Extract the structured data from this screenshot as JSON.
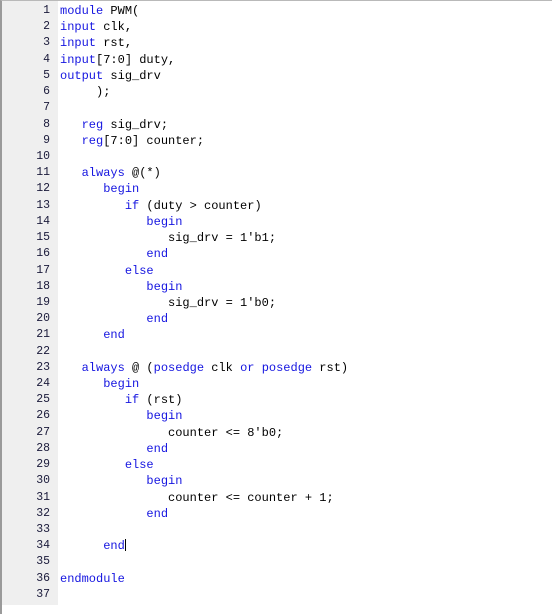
{
  "editor": {
    "name": "verilog-code-editor",
    "language": "Verilog",
    "total_lines": 37,
    "cursor": {
      "line": 34,
      "column": 12
    },
    "colors": {
      "background": "#ffffff",
      "gutter_background": "#efefef",
      "keyword": "#1515e0",
      "plain_text": "#000000",
      "line_number": "#1a1a3a",
      "left_border": "#9a9a9a"
    },
    "line_numbers": [
      "1",
      "2",
      "3",
      "4",
      "5",
      "6",
      "7",
      "8",
      "9",
      "10",
      "11",
      "12",
      "13",
      "14",
      "15",
      "16",
      "17",
      "18",
      "19",
      "20",
      "21",
      "22",
      "23",
      "24",
      "25",
      "26",
      "27",
      "28",
      "29",
      "30",
      "31",
      "32",
      "33",
      "34",
      "35",
      "36",
      "37"
    ],
    "lines": [
      {
        "n": 1,
        "tokens": [
          {
            "t": "module",
            "k": true
          },
          {
            "t": " PWM(",
            "k": false
          }
        ]
      },
      {
        "n": 2,
        "tokens": [
          {
            "t": "input",
            "k": true
          },
          {
            "t": " clk,",
            "k": false
          }
        ]
      },
      {
        "n": 3,
        "tokens": [
          {
            "t": "input",
            "k": true
          },
          {
            "t": " rst,",
            "k": false
          }
        ]
      },
      {
        "n": 4,
        "tokens": [
          {
            "t": "input",
            "k": true
          },
          {
            "t": "[7:0] duty,",
            "k": false
          }
        ]
      },
      {
        "n": 5,
        "tokens": [
          {
            "t": "output",
            "k": true
          },
          {
            "t": " sig_drv",
            "k": false
          }
        ]
      },
      {
        "n": 6,
        "tokens": [
          {
            "t": "     );",
            "k": false
          }
        ]
      },
      {
        "n": 7,
        "tokens": [
          {
            "t": "",
            "k": false
          }
        ]
      },
      {
        "n": 8,
        "tokens": [
          {
            "t": "   ",
            "k": false
          },
          {
            "t": "reg",
            "k": true
          },
          {
            "t": " sig_drv;",
            "k": false
          }
        ]
      },
      {
        "n": 9,
        "tokens": [
          {
            "t": "   ",
            "k": false
          },
          {
            "t": "reg",
            "k": true
          },
          {
            "t": "[7:0] counter;",
            "k": false
          }
        ]
      },
      {
        "n": 10,
        "tokens": [
          {
            "t": "",
            "k": false
          }
        ]
      },
      {
        "n": 11,
        "tokens": [
          {
            "t": "   ",
            "k": false
          },
          {
            "t": "always",
            "k": true
          },
          {
            "t": " @(*)",
            "k": false
          }
        ]
      },
      {
        "n": 12,
        "tokens": [
          {
            "t": "      ",
            "k": false
          },
          {
            "t": "begin",
            "k": true
          }
        ]
      },
      {
        "n": 13,
        "tokens": [
          {
            "t": "         ",
            "k": false
          },
          {
            "t": "if",
            "k": true
          },
          {
            "t": " (duty > counter)",
            "k": false
          }
        ]
      },
      {
        "n": 14,
        "tokens": [
          {
            "t": "            ",
            "k": false
          },
          {
            "t": "begin",
            "k": true
          }
        ]
      },
      {
        "n": 15,
        "tokens": [
          {
            "t": "               sig_drv = 1'b1;",
            "k": false
          }
        ]
      },
      {
        "n": 16,
        "tokens": [
          {
            "t": "            ",
            "k": false
          },
          {
            "t": "end",
            "k": true
          }
        ]
      },
      {
        "n": 17,
        "tokens": [
          {
            "t": "         ",
            "k": false
          },
          {
            "t": "else",
            "k": true
          }
        ]
      },
      {
        "n": 18,
        "tokens": [
          {
            "t": "            ",
            "k": false
          },
          {
            "t": "begin",
            "k": true
          }
        ]
      },
      {
        "n": 19,
        "tokens": [
          {
            "t": "               sig_drv = 1'b0;",
            "k": false
          }
        ]
      },
      {
        "n": 20,
        "tokens": [
          {
            "t": "            ",
            "k": false
          },
          {
            "t": "end",
            "k": true
          }
        ]
      },
      {
        "n": 21,
        "tokens": [
          {
            "t": "      ",
            "k": false
          },
          {
            "t": "end",
            "k": true
          }
        ]
      },
      {
        "n": 22,
        "tokens": [
          {
            "t": "",
            "k": false
          }
        ]
      },
      {
        "n": 23,
        "tokens": [
          {
            "t": "   ",
            "k": false
          },
          {
            "t": "always",
            "k": true
          },
          {
            "t": " @ (",
            "k": false
          },
          {
            "t": "posedge",
            "k": true
          },
          {
            "t": " clk ",
            "k": false
          },
          {
            "t": "or",
            "k": true
          },
          {
            "t": " ",
            "k": false
          },
          {
            "t": "posedge",
            "k": true
          },
          {
            "t": " rst)",
            "k": false
          }
        ]
      },
      {
        "n": 24,
        "tokens": [
          {
            "t": "      ",
            "k": false
          },
          {
            "t": "begin",
            "k": true
          }
        ]
      },
      {
        "n": 25,
        "tokens": [
          {
            "t": "         ",
            "k": false
          },
          {
            "t": "if",
            "k": true
          },
          {
            "t": " (rst)",
            "k": false
          }
        ]
      },
      {
        "n": 26,
        "tokens": [
          {
            "t": "            ",
            "k": false
          },
          {
            "t": "begin",
            "k": true
          }
        ]
      },
      {
        "n": 27,
        "tokens": [
          {
            "t": "               counter <= 8'b0;",
            "k": false
          }
        ]
      },
      {
        "n": 28,
        "tokens": [
          {
            "t": "            ",
            "k": false
          },
          {
            "t": "end",
            "k": true
          }
        ]
      },
      {
        "n": 29,
        "tokens": [
          {
            "t": "         ",
            "k": false
          },
          {
            "t": "else",
            "k": true
          }
        ]
      },
      {
        "n": 30,
        "tokens": [
          {
            "t": "            ",
            "k": false
          },
          {
            "t": "begin",
            "k": true
          }
        ]
      },
      {
        "n": 31,
        "tokens": [
          {
            "t": "               counter <= counter + 1;",
            "k": false
          }
        ]
      },
      {
        "n": 32,
        "tokens": [
          {
            "t": "            ",
            "k": false
          },
          {
            "t": "end",
            "k": true
          }
        ]
      },
      {
        "n": 33,
        "tokens": [
          {
            "t": "",
            "k": false
          }
        ]
      },
      {
        "n": 34,
        "tokens": [
          {
            "t": "      ",
            "k": false
          },
          {
            "t": "end",
            "k": true
          }
        ],
        "caret_after": true
      },
      {
        "n": 35,
        "tokens": [
          {
            "t": "",
            "k": false
          }
        ]
      },
      {
        "n": 36,
        "tokens": [
          {
            "t": "endmodule",
            "k": true
          }
        ]
      },
      {
        "n": 37,
        "tokens": [
          {
            "t": "",
            "k": false
          }
        ]
      }
    ]
  }
}
